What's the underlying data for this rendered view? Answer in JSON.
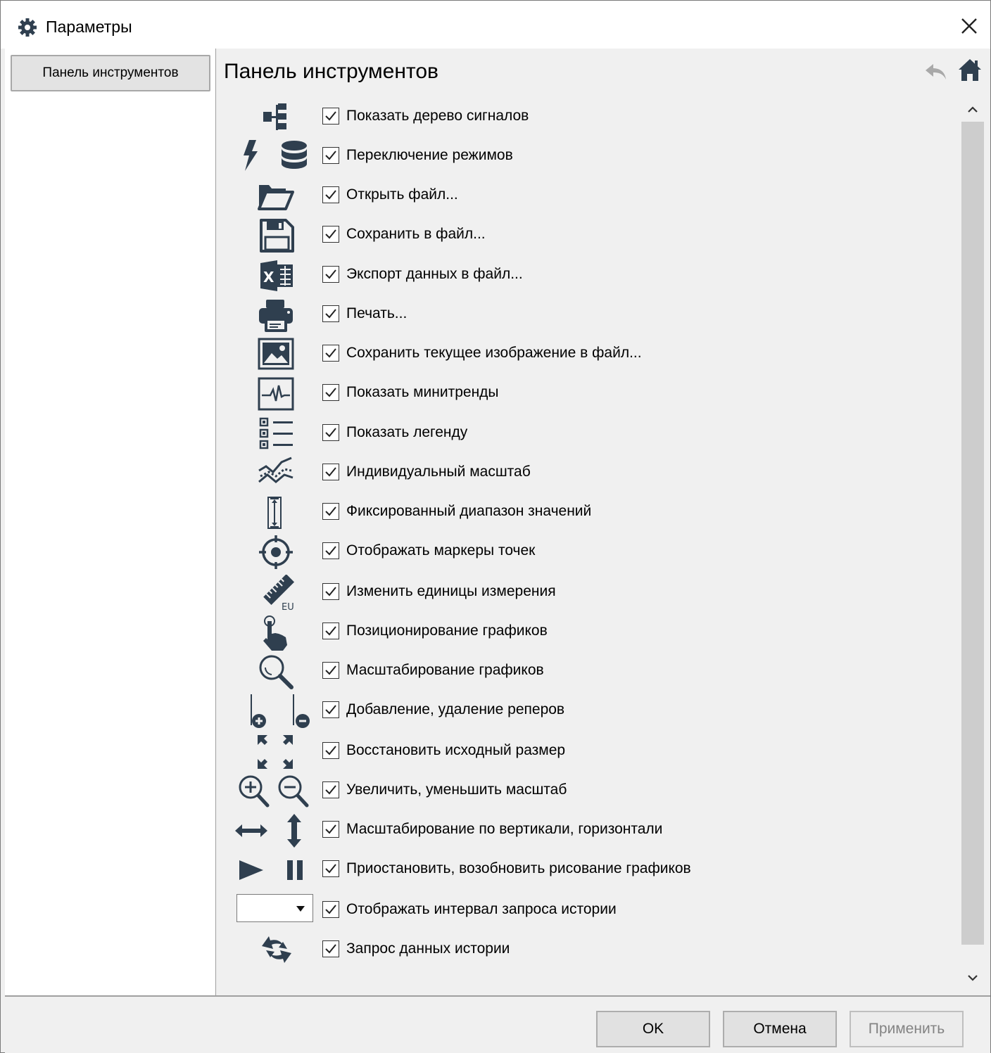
{
  "window": {
    "title": "Параметры"
  },
  "sidebar": {
    "items": [
      {
        "label": "Панель инструментов"
      }
    ]
  },
  "content": {
    "title": "Панель инструментов",
    "rows": [
      {
        "label": "Показать дерево сигналов",
        "checked": true,
        "icon": "signal-tree-icon"
      },
      {
        "label": "Переключение режимов",
        "checked": true,
        "icon": "mode-switch-icon"
      },
      {
        "label": "Открыть файл...",
        "checked": true,
        "icon": "folder-open-icon"
      },
      {
        "label": "Сохранить в файл...",
        "checked": true,
        "icon": "save-icon"
      },
      {
        "label": "Экспорт данных в файл...",
        "checked": true,
        "icon": "excel-export-icon"
      },
      {
        "label": "Печать...",
        "checked": true,
        "icon": "printer-icon"
      },
      {
        "label": "Сохранить текущее изображение в файл...",
        "checked": true,
        "icon": "image-icon"
      },
      {
        "label": "Показать минитренды",
        "checked": true,
        "icon": "minitrend-icon"
      },
      {
        "label": "Показать легенду",
        "checked": true,
        "icon": "legend-list-icon"
      },
      {
        "label": "Индивидуальный масштаб",
        "checked": true,
        "icon": "individual-scale-icon"
      },
      {
        "label": "Фиксированный диапазон значений",
        "checked": true,
        "icon": "fixed-range-icon"
      },
      {
        "label": "Отображать маркеры точек",
        "checked": true,
        "icon": "crosshair-icon"
      },
      {
        "label": "Изменить единицы измерения",
        "checked": true,
        "icon": "ruler-eu-icon",
        "icon_text": "EU"
      },
      {
        "label": "Позиционирование графиков",
        "checked": true,
        "icon": "hand-pointer-icon"
      },
      {
        "label": "Масштабирование графиков",
        "checked": true,
        "icon": "magnifier-icon"
      },
      {
        "label": "Добавление, удаление реперов",
        "checked": true,
        "icon": "marker-add-remove-icon"
      },
      {
        "label": "Восстановить исходный размер",
        "checked": true,
        "icon": "restore-size-icon"
      },
      {
        "label": "Увеличить, уменьшить масштаб",
        "checked": true,
        "icon": "zoom-in-out-icon"
      },
      {
        "label": "Масштабирование по вертикали, горизонтали",
        "checked": true,
        "icon": "scale-axes-icon"
      },
      {
        "label": "Приостановить, возобновить рисование графиков",
        "checked": true,
        "icon": "play-pause-icon"
      },
      {
        "label": "Отображать интервал запроса истории",
        "checked": true,
        "icon": "interval-combo"
      },
      {
        "label": "Запрос данных истории",
        "checked": true,
        "icon": "history-refresh-icon"
      }
    ]
  },
  "footer": {
    "ok_label": "OK",
    "cancel_label": "Отмена",
    "apply_label": "Применить"
  },
  "colors": {
    "icon": "#2f3f4f",
    "panel_bg": "#f0f0f0",
    "scroll_thumb": "#cdcdcd"
  }
}
